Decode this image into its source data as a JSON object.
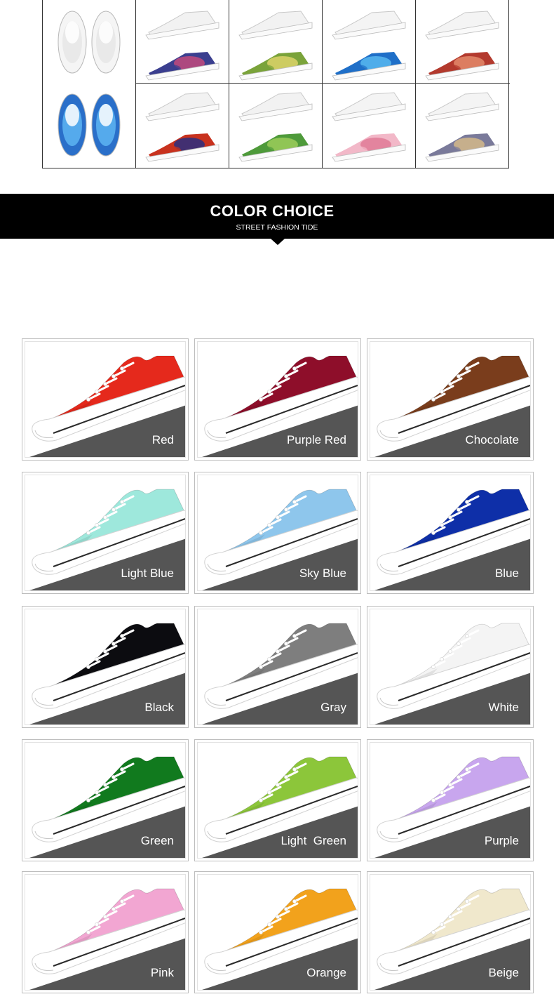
{
  "top_grid": {
    "cells": [
      {
        "name": "slip-on-white",
        "colors": [
          "#f5f5f5",
          "#e8e8e8"
        ]
      },
      {
        "name": "lowtop-white-galaxy",
        "colors": [
          "#f2f2f2",
          "#3b3f8f",
          "#c24a7c"
        ]
      },
      {
        "name": "lowtop-white-camo",
        "colors": [
          "#f2f2f2",
          "#7aa33a",
          "#dcd36a"
        ]
      },
      {
        "name": "runner-white-ocean",
        "colors": [
          "#f4f4f4",
          "#1f6fc8",
          "#58b8f0"
        ]
      },
      {
        "name": "boot-white-floral",
        "colors": [
          "#f4f4f4",
          "#b33a2e",
          "#e38a6a"
        ]
      },
      {
        "name": "slip-on-blue-art",
        "colors": [
          "#2a6fc9",
          "#5ab0f0"
        ]
      },
      {
        "name": "hightop-white-nebula",
        "colors": [
          "#f2f2f2",
          "#c8321e",
          "#2a2f80"
        ]
      },
      {
        "name": "hightop-white-camo",
        "colors": [
          "#f2f2f2",
          "#4e9a3a",
          "#9ccc5a"
        ]
      },
      {
        "name": "runner-white-pink-floral",
        "colors": [
          "#f4f4f4",
          "#f2b8c8",
          "#e07a96"
        ]
      },
      {
        "name": "boot-white-graffiti",
        "colors": [
          "#f4f4f4",
          "#7a7a9a",
          "#d4b98a"
        ]
      }
    ]
  },
  "banner": {
    "title": "COLOR CHOICE",
    "subtitle": "STREET FASHION TIDE"
  },
  "colors": [
    {
      "label": "Red",
      "hex": "#e5291c"
    },
    {
      "label": "Purple Red",
      "hex": "#8e0e2a"
    },
    {
      "label": "Chocolate",
      "hex": "#7a3d1c"
    },
    {
      "label": "Light Blue",
      "hex": "#9ee8dc"
    },
    {
      "label": "Sky Blue",
      "hex": "#8ec6ec"
    },
    {
      "label": "Blue",
      "hex": "#0e2fa8"
    },
    {
      "label": "Black",
      "hex": "#0c0c10"
    },
    {
      "label": "Gray",
      "hex": "#7e7e7e"
    },
    {
      "label": "White",
      "hex": "#f4f4f4"
    },
    {
      "label": "Green",
      "hex": "#117a1e"
    },
    {
      "label": "Light  Green",
      "hex": "#8cc63a"
    },
    {
      "label": "Purple",
      "hex": "#c8a6ee"
    },
    {
      "label": "Pink",
      "hex": "#f2a6d2"
    },
    {
      "label": "Orange",
      "hex": "#f2a21c"
    },
    {
      "label": "Beige",
      "hex": "#f0e8cc"
    }
  ]
}
